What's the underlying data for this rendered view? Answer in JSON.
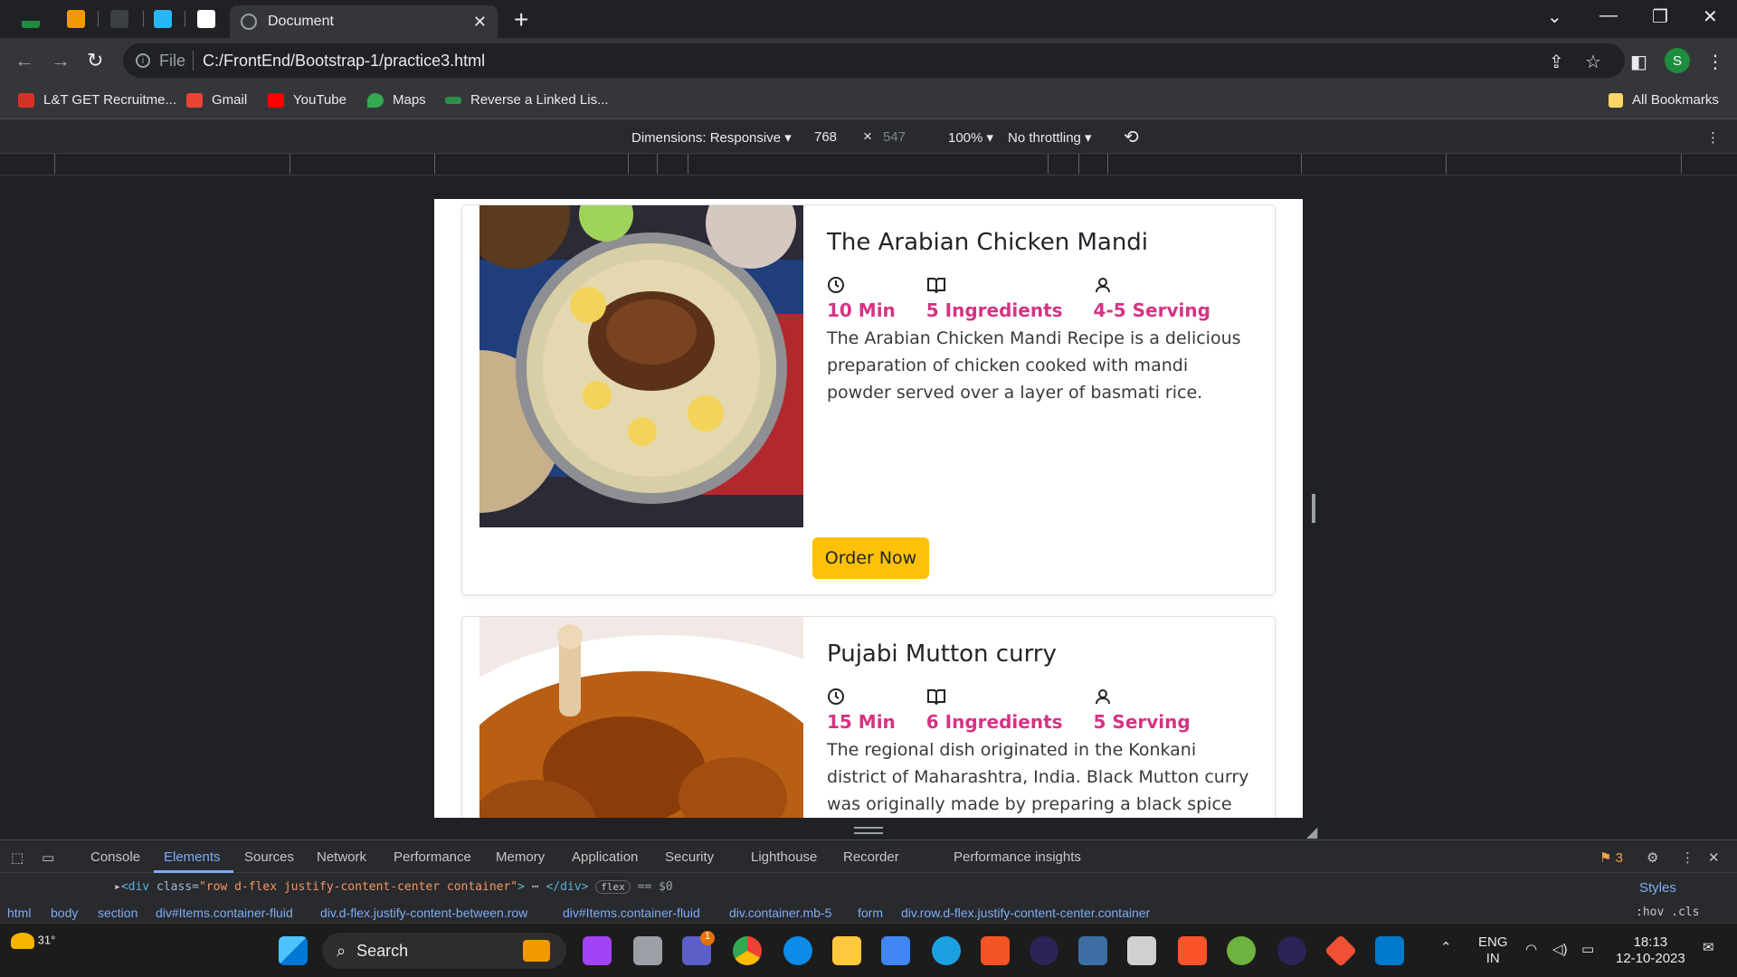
{
  "browser": {
    "tab_title": "Document",
    "url_scheme": "File",
    "url": "C:/FrontEnd/Bootstrap-1/practice3.html",
    "profile_initial": "S",
    "bookmarks": [
      {
        "label": "L&T GET Recruitme...",
        "color": "#d93025"
      },
      {
        "label": "Gmail",
        "color": "#ea4335"
      },
      {
        "label": "YouTube",
        "color": "#ff0000"
      },
      {
        "label": "Maps",
        "color": "#34a853"
      },
      {
        "label": "Reverse a Linked Lis...",
        "color": "#2f8d46"
      }
    ],
    "all_bookmarks": "All Bookmarks"
  },
  "device_toolbar": {
    "dimensions": "Dimensions: Responsive",
    "width": "768",
    "times": "×",
    "height": "547",
    "zoom": "100%",
    "throttling": "No throttling"
  },
  "recipes": [
    {
      "title": "The Arabian Chicken Mandi",
      "time": "10 Min",
      "ingredients": "5 Ingredients",
      "serving": "4-5 Serving",
      "description": "The Arabian Chicken Mandi Recipe is a delicious preparation of chicken cooked with mandi powder served over a layer of basmati rice.",
      "button": "Order Now"
    },
    {
      "title": "Pujabi Mutton curry",
      "time": "15 Min",
      "ingredients": "6 Ingredients",
      "serving": "5 Serving",
      "description": "The regional dish originated in the Konkani district of Maharashtra, India. Black Mutton curry was originally made by preparing a black spice paste"
    }
  ],
  "devtools": {
    "tabs": [
      "Console",
      "Elements",
      "Sources",
      "Network",
      "Performance",
      "Memory",
      "Application",
      "Security",
      "Lighthouse",
      "Recorder",
      "Performance insights"
    ],
    "active_tab": "Elements",
    "issues_count": "3",
    "dom_tag_open": "<div",
    "dom_attr": " class=",
    "dom_value": "\"row d-flex justify-content-center container\"",
    "dom_close": ">",
    "dom_ellipsis": "⋯",
    "dom_end": "</div>",
    "dom_badge": "flex",
    "dom_eq": "== $0",
    "breadcrumbs": [
      "html",
      "body",
      "section",
      "div#Items.container-fluid",
      "div.d-flex.justify-content-between.row",
      "div#Items.container-fluid",
      "div.container.mb-5",
      "form",
      "div.row.d-flex.justify-content-center.container"
    ],
    "styles": "Styles",
    "hov_cls": ":hov  .cls"
  },
  "taskbar": {
    "weather": "31°",
    "search": "Search",
    "lang_line1": "ENG",
    "lang_line2": "IN",
    "time": "18:13",
    "date": "12-10-2023",
    "chat_badge": "1"
  }
}
